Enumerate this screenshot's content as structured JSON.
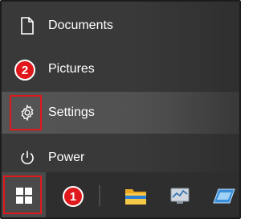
{
  "menu": {
    "items": [
      {
        "label": "Documents",
        "icon": "document-icon"
      },
      {
        "label": "Pictures",
        "icon": "picture-icon"
      },
      {
        "label": "Settings",
        "icon": "gear-icon"
      },
      {
        "label": "Power",
        "icon": "power-icon"
      }
    ]
  },
  "annotations": {
    "badge_1": "1",
    "badge_2": "2",
    "highlight_color": "#e0181b"
  },
  "taskbar": {
    "start_icon": "windows-logo-icon",
    "pinned": [
      "file-explorer-icon",
      "task-manager-icon",
      "app-icon"
    ]
  }
}
